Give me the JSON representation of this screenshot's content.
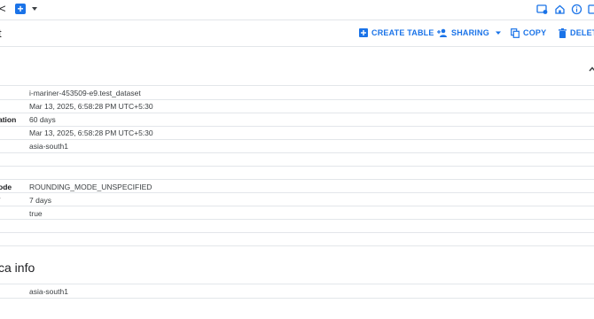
{
  "tab": {
    "close_glyph": "<"
  },
  "toolbar": {
    "title": "t",
    "create_table": "CREATE TABLE",
    "sharing": "SHARING",
    "copy": "COPY",
    "delete": "DELETE"
  },
  "details": [
    {
      "key": "",
      "value": "i-mariner-453509-e9.test_dataset"
    },
    {
      "key": "",
      "value": "Mar 13, 2025, 6:58:28 PM UTC+5:30"
    },
    {
      "key": "ation",
      "value": "60 days"
    },
    {
      "key": "",
      "value": "Mar 13, 2025, 6:58:28 PM UTC+5:30"
    },
    {
      "key": "",
      "value": "asia-south1"
    },
    {
      "key": "",
      "value": ""
    },
    {
      "key": "",
      "value": ""
    },
    {
      "key": "ode",
      "value": "ROUNDING_MODE_UNSPECIFIED"
    },
    {
      "key": "/",
      "value": "7 days"
    },
    {
      "key": "",
      "value": "true"
    },
    {
      "key": "",
      "value": ""
    }
  ],
  "replica": {
    "title": "ca info",
    "rows": [
      {
        "key": "",
        "value": "asia-south1"
      }
    ]
  },
  "colors": {
    "accent": "#1a73e8",
    "divider": "#e3e6ea"
  },
  "icons": [
    "close-icon",
    "add-tab-icon",
    "tab-dropdown-icon",
    "cloud-shell-icon",
    "home-icon",
    "info-icon",
    "more-icon",
    "create-table-icon",
    "sharing-icon",
    "copy-icon",
    "delete-icon",
    "collapse-icon"
  ]
}
